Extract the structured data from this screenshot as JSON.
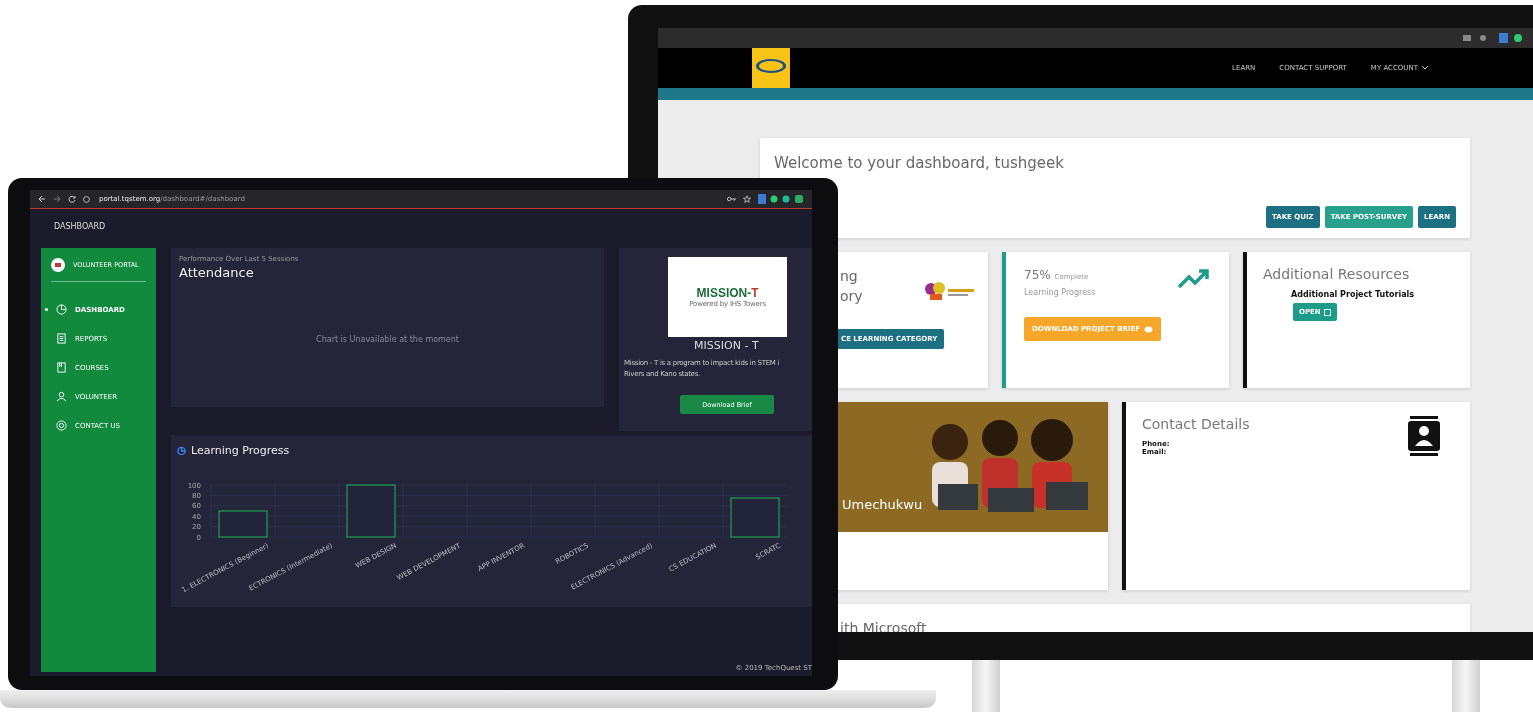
{
  "laptop": {
    "browser": {
      "url_host": "portal.tqstem.org",
      "url_path": "/dashboard#/dashboard"
    },
    "page_title": "DASHBOARD",
    "sidebar": {
      "title": "VOLUNTEER PORTAL",
      "items": [
        {
          "label": "DASHBOARD",
          "selected": true
        },
        {
          "label": "REPORTS",
          "selected": false
        },
        {
          "label": "COURSES",
          "selected": false
        },
        {
          "label": "VOLUNTEER",
          "selected": false
        },
        {
          "label": "CONTACT US",
          "selected": false
        }
      ]
    },
    "attendance": {
      "subtitle": "Performance Over Last 5 Sessions",
      "title": "Attendance",
      "message": "Chart is Unavailable at the moment"
    },
    "mission": {
      "logo": {
        "name": "MISSION-",
        "accent": "T",
        "tagline": "Powered by IHS Towers"
      },
      "title": "MISSION - T",
      "description_lines": [
        "Mission - T is a program to impact kids in STEM i",
        "Rivers and Kano states."
      ],
      "button": "Download Brief"
    },
    "learning": {
      "title": "Learning Progress",
      "chart_data": {
        "type": "bar",
        "categories": [
          "1. ELECTRONICS (Beginner)",
          "ECTRONICS (Intermediate)",
          "WEB DESIGN",
          "WEB DEVELOPMENT",
          "APP INVENTOR",
          "ROBOTICS",
          "ELECTRONICS (Advanced)",
          "CS EDUCATION",
          "SCRATC"
        ],
        "series": [
          {
            "color": "#1db954",
            "values": [
              50,
              0,
              100,
              0,
              0,
              0,
              0,
              0,
              75
            ]
          }
        ],
        "ylim": [
          0,
          100
        ],
        "yticks": [
          0,
          20,
          40,
          60,
          80,
          100
        ],
        "grid": true
      }
    },
    "footer": "© 2019 TechQuest ST"
  },
  "monitor": {
    "nav": [
      "LEARN",
      "CONTACT SUPPORT",
      "MY ACCOUNT"
    ],
    "welcome": "Welcome to your dashboard, tushgeek",
    "buttons": [
      {
        "label": "TAKE QUIZ",
        "kind": "dark"
      },
      {
        "label": "TAKE POST-SURVEY",
        "kind": "light"
      },
      {
        "label": "LEARN",
        "kind": "dark"
      }
    ],
    "category_card": {
      "title_lines": [
        "ng",
        "ory"
      ],
      "button": "CE LEARNING CATEGORY"
    },
    "progress_card": {
      "percent": "75%",
      "percent_label": "Complete",
      "label": "Learning Progress",
      "button": "DOWNLOAD PROJECT BRIEF"
    },
    "resources_card": {
      "title": "Additional Resources",
      "item": "Additional Project Tutorials",
      "button": "OPEN"
    },
    "profile_card": {
      "name": "Umechukwu"
    },
    "contact_card": {
      "title": "Contact Details",
      "phone_label": "Phone:",
      "email_label": "Email:"
    },
    "bottom_card": {
      "title": "ith Microsoft"
    }
  }
}
